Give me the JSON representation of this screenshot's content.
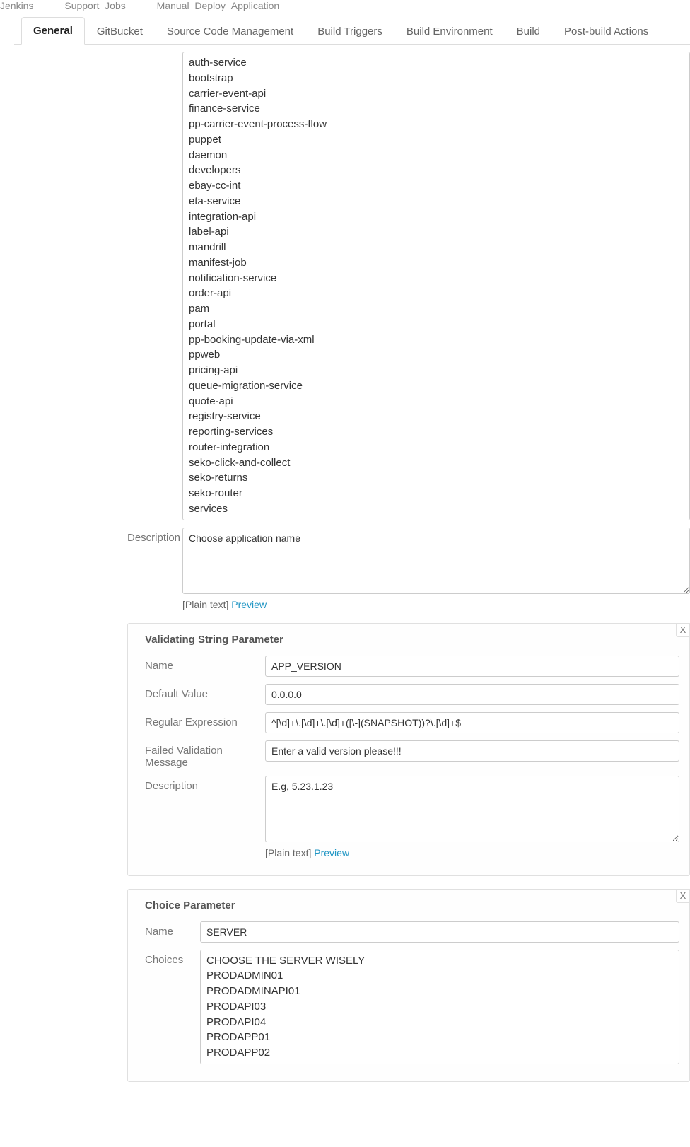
{
  "breadcrumb": [
    "Jenkins",
    "Support_Jobs",
    "Manual_Deploy_Application"
  ],
  "tabs": [
    "General",
    "GitBucket",
    "Source Code Management",
    "Build Triggers",
    "Build Environment",
    "Build",
    "Post-build Actions"
  ],
  "active_tab_index": 0,
  "app_choices_items": [
    "auth-service",
    "bootstrap",
    "carrier-event-api",
    "finance-service",
    "pp-carrier-event-process-flow",
    "puppet",
    "daemon",
    "developers",
    "ebay-cc-int",
    "eta-service",
    "integration-api",
    "label-api",
    "mandrill",
    "manifest-job",
    "notification-service",
    "order-api",
    "pam",
    "portal",
    "pp-booking-update-via-xml",
    "ppweb",
    "pricing-api",
    "queue-migration-service",
    "quote-api",
    "registry-service",
    "reporting-services",
    "router-integration",
    "seko-click-and-collect",
    "seko-returns",
    "seko-router",
    "services"
  ],
  "app_choices_description_label": "Description",
  "app_choices_description_value": "Choose application name",
  "plain_text_label": "[Plain text] ",
  "preview_label": "Preview",
  "validating_section": {
    "title": "Validating String Parameter",
    "close": "X",
    "name_label": "Name",
    "name_value": "APP_VERSION",
    "default_label": "Default Value",
    "default_value": "0.0.0.0",
    "regex_label": "Regular Expression",
    "regex_value": "^[\\d]+\\.[\\d]+\\.[\\d]+([\\-](SNAPSHOT))?\\.[\\d]+$",
    "failmsg_label": "Failed Validation Message",
    "failmsg_value": "Enter a valid version please!!!",
    "desc_label": "Description",
    "desc_value": "E.g, 5.23.1.23"
  },
  "choice_section": {
    "title": "Choice Parameter",
    "close": "X",
    "name_label": "Name",
    "name_value": "SERVER",
    "choices_label": "Choices",
    "choices_items": [
      "CHOOSE THE SERVER WISELY",
      "PRODADMIN01",
      "PRODADMINAPI01",
      "PRODAPI03",
      "PRODAPI04",
      "PRODAPP01",
      "PRODAPP02"
    ]
  }
}
